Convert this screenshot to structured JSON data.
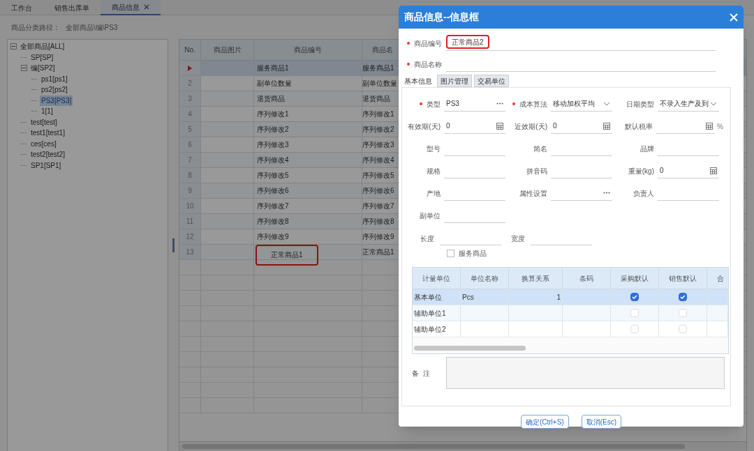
{
  "tabs": [
    {
      "label": "工作台",
      "selected": false,
      "closable": false
    },
    {
      "label": "销售出库单",
      "selected": false,
      "closable": false
    },
    {
      "label": "商品信息",
      "selected": true,
      "closable": true
    }
  ],
  "path": {
    "label": "商品分类路径：",
    "value": "全部商品\\编\\PS3"
  },
  "tree": [
    {
      "label": "全部商品[ALL]",
      "selected": false,
      "expanded": true,
      "children": [
        {
          "label": "SP[SP]",
          "selected": false
        },
        {
          "label": "编[SP2]",
          "selected": false,
          "expanded": true,
          "children": [
            {
              "label": "ps1[ps1]",
              "selected": false
            },
            {
              "label": "ps2[ps2]",
              "selected": false
            },
            {
              "label": "PS3[PS3]",
              "selected": true
            },
            {
              "label": "1[1]",
              "selected": false
            }
          ]
        },
        {
          "label": "test[test]",
          "selected": false
        },
        {
          "label": "test1[test1]",
          "selected": false
        },
        {
          "label": "ces[ces]",
          "selected": false
        },
        {
          "label": "test2[test2]",
          "selected": false
        },
        {
          "label": "SP1[SP1]",
          "selected": false
        }
      ]
    }
  ],
  "grid": {
    "columns": [
      "No.",
      "商品图片",
      "商品编号",
      "商品名"
    ],
    "rows": [
      {
        "selected": true,
        "code": "服务商品1",
        "name": "服务商品1",
        "highlighted": false
      },
      {
        "no": "2",
        "selected": false,
        "code": "副单位数量",
        "name": "副单位数量",
        "highlighted": false
      },
      {
        "no": "3",
        "selected": false,
        "code": "退货商品",
        "name": "退货商品",
        "highlighted": false
      },
      {
        "no": "4",
        "selected": false,
        "code": "序列修改1",
        "name": "序列修改1",
        "highlighted": false
      },
      {
        "no": "5",
        "selected": false,
        "code": "序列修改2",
        "name": "序列修改2",
        "highlighted": false
      },
      {
        "no": "6",
        "selected": false,
        "code": "序列修改3",
        "name": "序列修改3",
        "highlighted": false
      },
      {
        "no": "7",
        "selected": false,
        "code": "序列修改4",
        "name": "序列修改4",
        "highlighted": false
      },
      {
        "no": "8",
        "selected": false,
        "code": "序列修改5",
        "name": "序列修改5",
        "highlighted": false
      },
      {
        "no": "9",
        "selected": false,
        "code": "序列修改6",
        "name": "序列修改6",
        "highlighted": false
      },
      {
        "no": "10",
        "selected": false,
        "code": "序列修改7",
        "name": "序列修改7",
        "highlighted": false
      },
      {
        "no": "11",
        "selected": false,
        "code": "序列修改8",
        "name": "序列修改8",
        "highlighted": false
      },
      {
        "no": "12",
        "selected": false,
        "code": "序列修改9",
        "name": "序列修改9",
        "highlighted": false
      },
      {
        "no": "13",
        "selected": false,
        "code": "正常商品1",
        "name": "正常商品1",
        "highlighted": true
      }
    ]
  },
  "dialog": {
    "title": "商品信息--信息框",
    "code": {
      "label": "商品编号",
      "value": "正常商品2",
      "required": true,
      "highlighted": true
    },
    "name": {
      "label": "商品名称",
      "required": true
    },
    "tabs": [
      {
        "label": "基本信息",
        "selected": true
      },
      {
        "label": "图片管理",
        "selected": false
      },
      {
        "label": "交易单位",
        "selected": false
      }
    ],
    "fields": [
      {
        "label": "类型",
        "value": "PS3",
        "required": true,
        "kind": "lookup"
      },
      {
        "label": "成本算法",
        "value": "移动加权平均",
        "required": true,
        "kind": "select"
      },
      {
        "label": "日期类型",
        "value": "不录入生产及到",
        "required": false,
        "kind": "select"
      },
      {
        "label": "有效期(天)",
        "value": "0",
        "required": false,
        "kind": "number"
      },
      {
        "label": "近效期(天)",
        "value": "0",
        "required": false,
        "kind": "number"
      },
      {
        "label": "默认税率",
        "required": false,
        "kind": "number",
        "suffix": "%"
      },
      {
        "label": "型号",
        "required": false,
        "kind": "text"
      },
      {
        "label": "简名",
        "required": false,
        "kind": "text"
      },
      {
        "label": "品牌",
        "required": false,
        "kind": "text"
      },
      {
        "label": "规格",
        "required": false,
        "kind": "text"
      },
      {
        "label": "拼音码",
        "required": false,
        "kind": "text"
      },
      {
        "label": "重量(kg)",
        "value": "0",
        "required": false,
        "kind": "number"
      },
      {
        "label": "产地",
        "required": false,
        "kind": "text"
      },
      {
        "label": "属性设置",
        "required": false,
        "kind": "lookup"
      },
      {
        "label": "负责人",
        "required": false,
        "kind": "text"
      },
      {
        "label": "副单位",
        "required": false,
        "kind": "text"
      }
    ],
    "size_fields": [
      {
        "label": "长度"
      },
      {
        "label": "宽度"
      }
    ],
    "service_checkbox": {
      "label": "服务商品",
      "checked": false
    },
    "units": {
      "columns": [
        "计量单位",
        "单位名称",
        "换算关系",
        "条码",
        "采购默认",
        "销售默认",
        "合"
      ],
      "rows": [
        {
          "unit": "基本单位",
          "name": "Pcs",
          "ratio": "1",
          "purchase_default": true,
          "sales_default": true,
          "selected": true
        },
        {
          "unit": "辅助单位1",
          "purchase_default": false,
          "sales_default": false,
          "selected": false
        },
        {
          "unit": "辅助单位2",
          "purchase_default": false,
          "sales_default": false,
          "selected": false
        }
      ]
    },
    "remark": {
      "label": "备  注"
    },
    "buttons": [
      "确定(Ctrl+S)",
      "取消(Esc)"
    ]
  }
}
